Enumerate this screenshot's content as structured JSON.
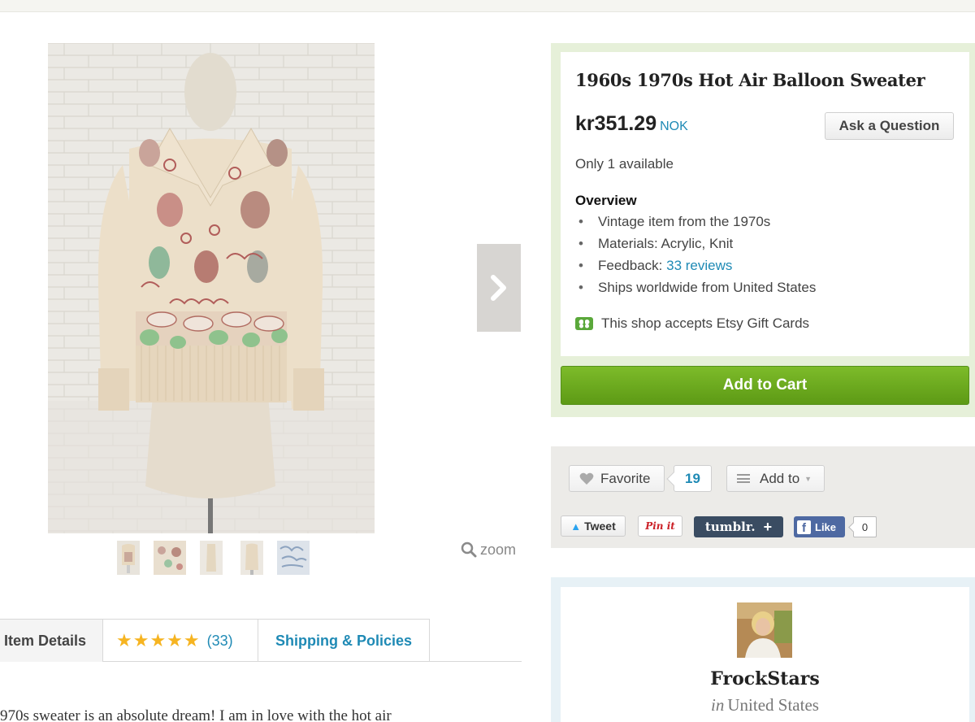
{
  "listing": {
    "title": "1960s 1970s Hot Air Balloon Sweater",
    "price": "kr351.29",
    "currency": "NOK",
    "ask_label": "Ask a Question",
    "availability": "Only 1 available",
    "overview_heading": "Overview",
    "overview": {
      "vintage": "Vintage item from the 1970s",
      "materials": "Materials: Acrylic, Knit",
      "feedback_prefix": "Feedback: ",
      "feedback_link": "33 reviews",
      "ships": "Ships worldwide from United States"
    },
    "gift_cards": "This shop accepts Etsy Gift Cards",
    "add_to_cart": "Add to Cart"
  },
  "gallery": {
    "zoom_label": "zoom",
    "thumbnail_count": 5
  },
  "social": {
    "favorite_label": "Favorite",
    "favorite_count": "19",
    "add_to_label": "Add to",
    "tweet_label": "Tweet",
    "pinit_label": "Pin it",
    "tumblr_label": "tumblr.",
    "tumblr_plus": "+",
    "like_label": "Like",
    "like_count": "0"
  },
  "tabs": {
    "item_details": "Item Details",
    "stars": "★★★★★",
    "review_count": "(33)",
    "shipping": "Shipping & Policies"
  },
  "description_snippet": "970s sweater is an absolute dream! I am in love with the hot air",
  "shop": {
    "name": "FrockStars",
    "location_prefix": "in",
    "location": "United States"
  },
  "colors": {
    "link_blue": "#1f8ab5",
    "cart_green": "#6aaa1f",
    "star_gold": "#f6b421"
  }
}
